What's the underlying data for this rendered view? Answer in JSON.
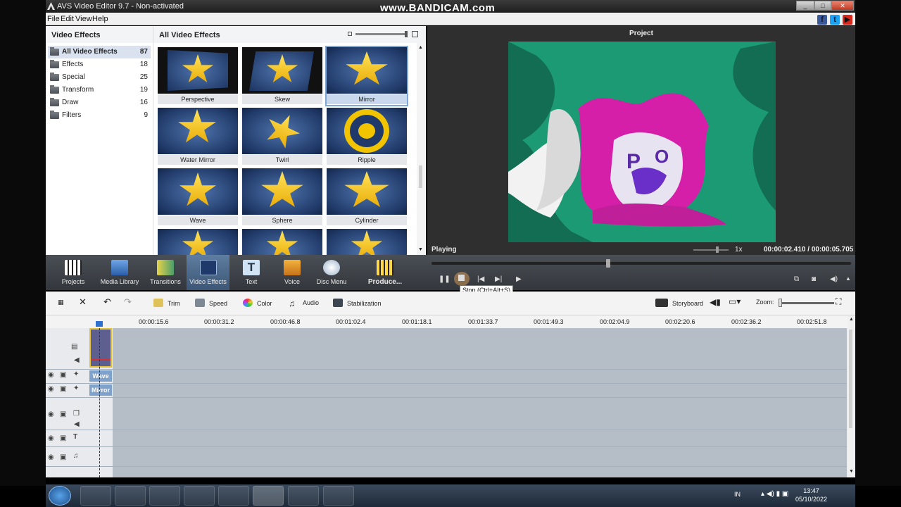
{
  "window": {
    "title": "AVS Video Editor 9.7 - Non-activated",
    "watermark": "www.BANDICAM.com",
    "min": "_",
    "max": "□",
    "close": "✕"
  },
  "menu": [
    "File",
    "Edit",
    "View",
    "Help"
  ],
  "social": [
    "f",
    "t",
    "▶"
  ],
  "left_panel": {
    "header": "Video Effects",
    "categories": [
      {
        "label": "All Video Effects",
        "count": "87"
      },
      {
        "label": "Effects",
        "count": "18"
      },
      {
        "label": "Special",
        "count": "25"
      },
      {
        "label": "Transform",
        "count": "19"
      },
      {
        "label": "Draw",
        "count": "16"
      },
      {
        "label": "Filters",
        "count": "9"
      }
    ]
  },
  "grid": {
    "header": "All Video Effects",
    "tiles": [
      "Perspective",
      "Skew",
      "Mirror",
      "Water Mirror",
      "Twirl",
      "Ripple",
      "Wave",
      "Sphere",
      "Cylinder"
    ]
  },
  "preview": {
    "title": "Project",
    "status": "Playing",
    "speed": "1x",
    "time": "00:00:02.410  /  00:00:05.705",
    "video_bg": "#1c9a74"
  },
  "toolbar": {
    "buttons": [
      "Projects",
      "Media Library",
      "Transitions",
      "Video Effects",
      "Text",
      "Voice",
      "Disc Menu",
      "Produce..."
    ],
    "tooltip": "Stop (Ctrl+Alt+S)"
  },
  "timeline_tools": {
    "trim": "Trim",
    "speed": "Speed",
    "color": "Color",
    "audio": "Audio",
    "stabilization": "Stabilization",
    "storyboard": "Storyboard",
    "zoom": "Zoom:"
  },
  "ruler": [
    "00:00:15.6",
    "00:00:31.2",
    "00:00:46.8",
    "00:01:02.4",
    "00:01:18.1",
    "00:01:33.7",
    "00:01:49.3",
    "00:02:04.9",
    "00:02:20.6",
    "00:02:36.2",
    "00:02:51.8"
  ],
  "clips": {
    "wave": "Wave",
    "mirror": "Mirror"
  },
  "taskbar": {
    "lang": "IN",
    "time": "13:47",
    "date": "05/10/2022"
  }
}
